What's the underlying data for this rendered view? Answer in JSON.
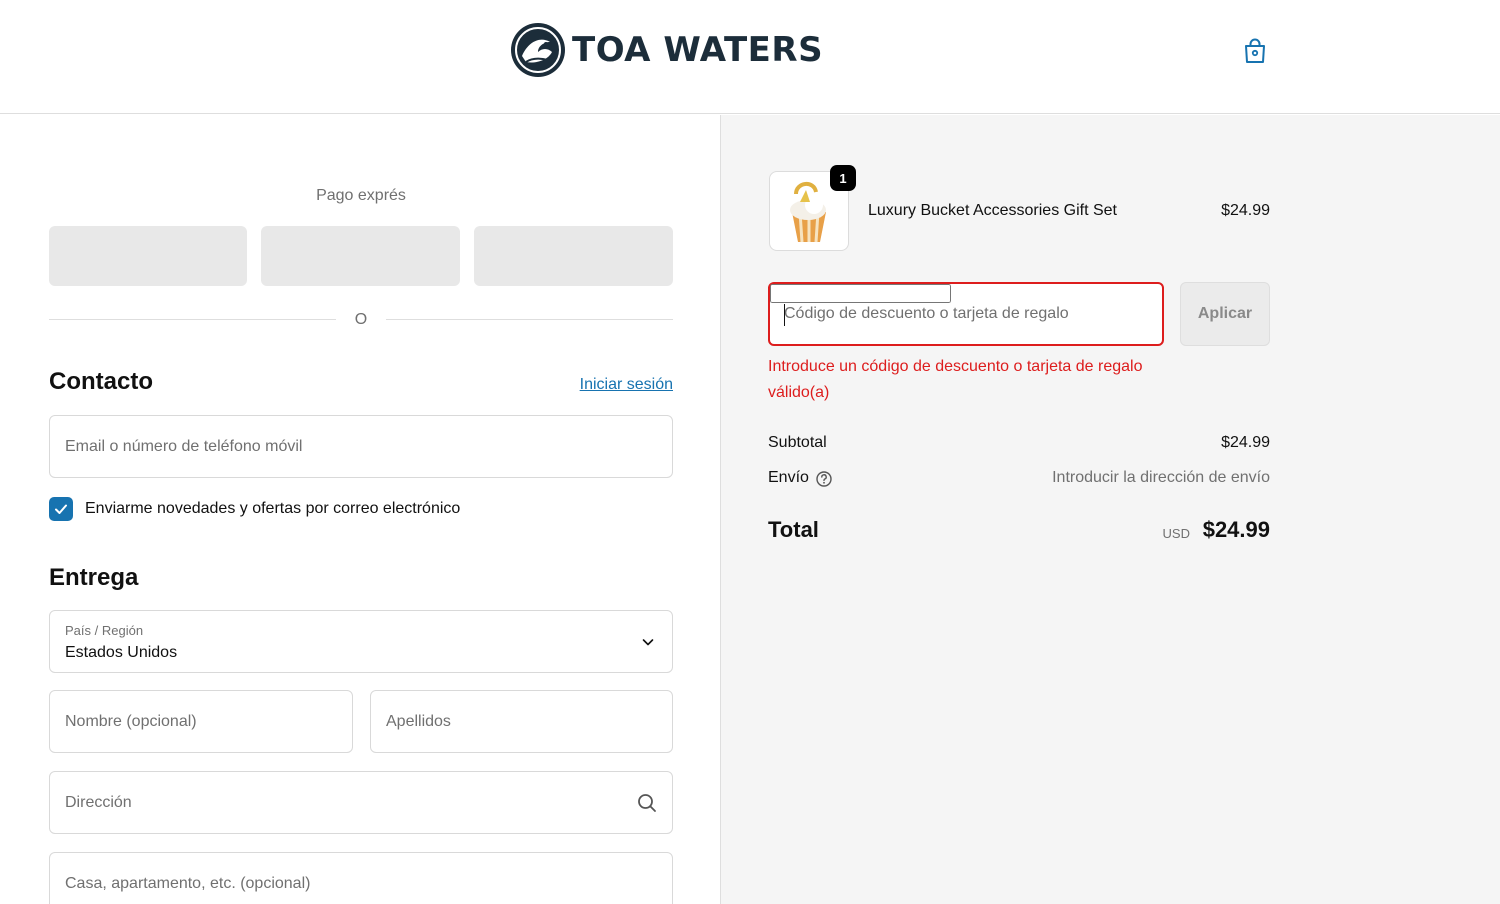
{
  "header": {
    "brand": "TOA WATERS",
    "cart_icon": "shopping-bag-icon"
  },
  "checkout": {
    "express": {
      "label": "Pago exprés",
      "divider": "O"
    },
    "contact": {
      "title": "Contacto",
      "login_link": "Iniciar sesión",
      "email_placeholder": "Email o número de teléfono móvil",
      "newsletter_label": "Enviarme novedades y ofertas por correo electrónico",
      "newsletter_checked": true
    },
    "delivery": {
      "title": "Entrega",
      "country_label": "País / Región",
      "country_value": "Estados Unidos",
      "first_name_placeholder": "Nombre (opcional)",
      "last_name_placeholder": "Apellidos",
      "address_placeholder": "Dirección",
      "apartment_placeholder": "Casa, apartamento, etc. (opcional)"
    }
  },
  "summary": {
    "item": {
      "quantity": "1",
      "name": "Luxury Bucket Accessories Gift Set",
      "price": "$24.99"
    },
    "discount": {
      "placeholder": "Código de descuento o tarjeta de regalo",
      "apply_label": "Aplicar",
      "error": "Introduce un código de descuento o tarjeta de regalo válido(a)"
    },
    "subtotal_label": "Subtotal",
    "subtotal_value": "$24.99",
    "shipping_label": "Envío",
    "shipping_value": "Introducir la dirección de envío",
    "total_label": "Total",
    "total_currency": "USD",
    "total_value": "$24.99"
  },
  "colors": {
    "accent": "#1773b0",
    "error": "#dd1d1d",
    "summary_bg": "#f5f5f5"
  }
}
